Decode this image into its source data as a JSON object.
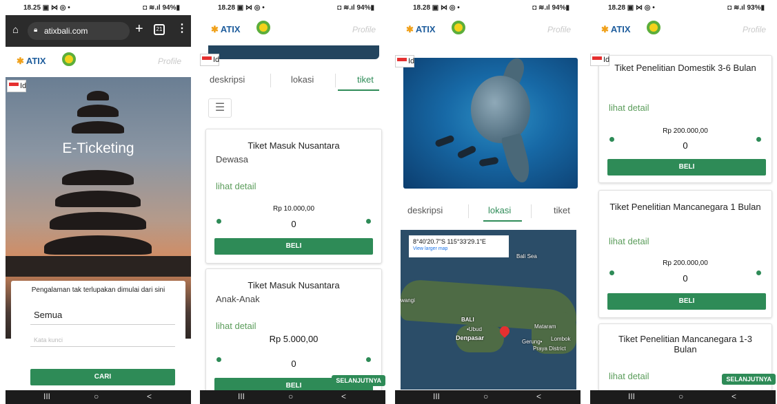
{
  "status": {
    "p1_time": "18.25 ▣ ⋈ ◎ •",
    "p2_time": "18.28 ▣ ⋈ ◎ •",
    "p3_time": "18.28 ▣ ⋈ ◎ •",
    "p4_time": "18.28 ▣ ⋈ ◎ •",
    "p1_right": "◘ ≋.ıl 94%▮",
    "p2_right": "◘ ≋.ıl 94%▮",
    "p3_right": "◘ ≋.ıl 94%▮",
    "p4_right": "◘ ≋.ıl 93%▮"
  },
  "browser": {
    "url": "atixbali.com",
    "tab_count": "21"
  },
  "app": {
    "logo_text": "ATIX",
    "profile_label": "Profile",
    "lang_label": "Id"
  },
  "home": {
    "hero_title": "E-Ticketing",
    "tagline": "Pengalaman tak terlupakan dimulai dari sini",
    "category_value": "Semua",
    "keyword_placeholder": "Kata kunci",
    "search_button": "CARI"
  },
  "tabs": {
    "deskripsi": "deskripsi",
    "lokasi": "lokasi",
    "tiket": "tiket"
  },
  "tickets_p2": [
    {
      "title": "Tiket Masuk Nusantara",
      "sub": "Dewasa",
      "detail": "lihat detail",
      "price": "Rp 10.000,00",
      "qty": "0",
      "buy": "BELI"
    },
    {
      "title": "Tiket Masuk Nusantara",
      "sub": "Anak-Anak",
      "detail": "lihat detail",
      "price": "Rp 5.000,00",
      "qty": "0",
      "buy": "BELI"
    }
  ],
  "tickets_p4": [
    {
      "title": "Tiket Penelitian Domestik 3-6 Bulan",
      "detail": "lihat detail",
      "price": "Rp 200.000,00",
      "qty": "0",
      "buy": "BELI"
    },
    {
      "title": "Tiket Penelitian Mancanegara 1 Bulan",
      "detail": "lihat detail",
      "price": "Rp 200.000,00",
      "qty": "0",
      "buy": "BELI"
    },
    {
      "title": "Tiket Penelitian Mancanegara 1-3 Bulan",
      "detail": "lihat detail"
    }
  ],
  "next_label": "SELANJUTNYA",
  "map": {
    "coords": "8°40'20.7\"S 115°33'29.1\"E",
    "larger": "View larger map",
    "bali_sea": "Bali Sea",
    "bali": "BALI",
    "ubud": "•Ubud",
    "denpasar": "Denpasar",
    "mataram": "Mataram",
    "lombok": "Lombok",
    "gerung": "Gerung•",
    "praya": "Praya District",
    "wangi": "wangi"
  },
  "nav": {
    "recent": "III",
    "home": "○",
    "back": "<"
  },
  "colors": {
    "accent": "#2e8b57",
    "browser_bar": "#2b2b2b"
  }
}
